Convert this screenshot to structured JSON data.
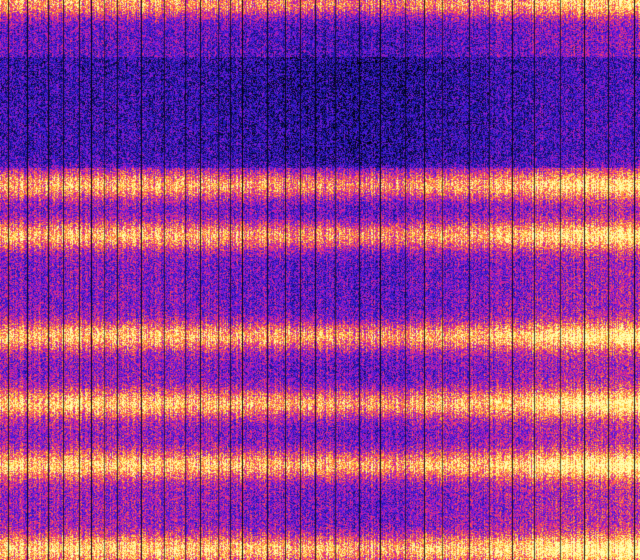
{
  "image": {
    "kind": "spectrogram",
    "colormap": [
      "#000000",
      "#10106a",
      "#2a1ad0",
      "#7a1bd8",
      "#d21fa0",
      "#ff5a46",
      "#ffcc3a",
      "#ffffb0"
    ],
    "background_color": "#000000",
    "bright_bands_from_top_fraction": [
      0.005,
      0.33,
      0.42,
      0.6,
      0.72,
      0.83,
      0.98
    ],
    "dark_region_from_top_fraction": [
      0.1,
      0.3
    ],
    "vertical_separator_color": "#000000"
  }
}
